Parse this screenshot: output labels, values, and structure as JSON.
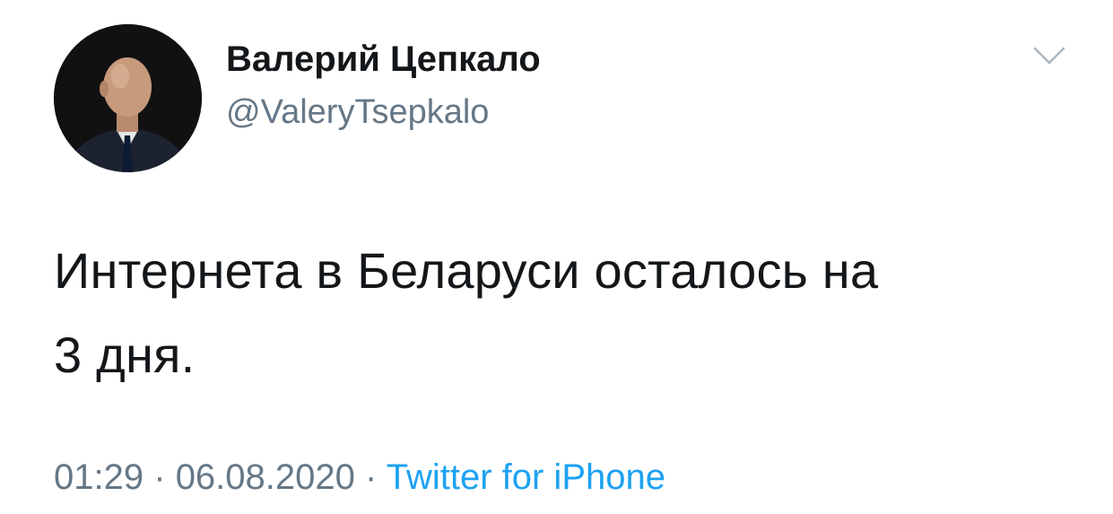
{
  "tweet": {
    "author": {
      "display_name": "Валерий Цепкало",
      "handle": "@ValeryTsepkalo",
      "avatar_icon": "profile-photo"
    },
    "menu_icon": "chevron-down-icon",
    "text_line_1": "Интернета в Беларуси осталось на",
    "text_line_2": "3 дня.",
    "time": "01:29",
    "separator": "·",
    "date": "06.08.2020",
    "source": "Twitter for iPhone"
  },
  "colors": {
    "text": "#14171a",
    "secondary": "#657786",
    "link": "#1da1f2",
    "caret": "#aab8c2"
  }
}
